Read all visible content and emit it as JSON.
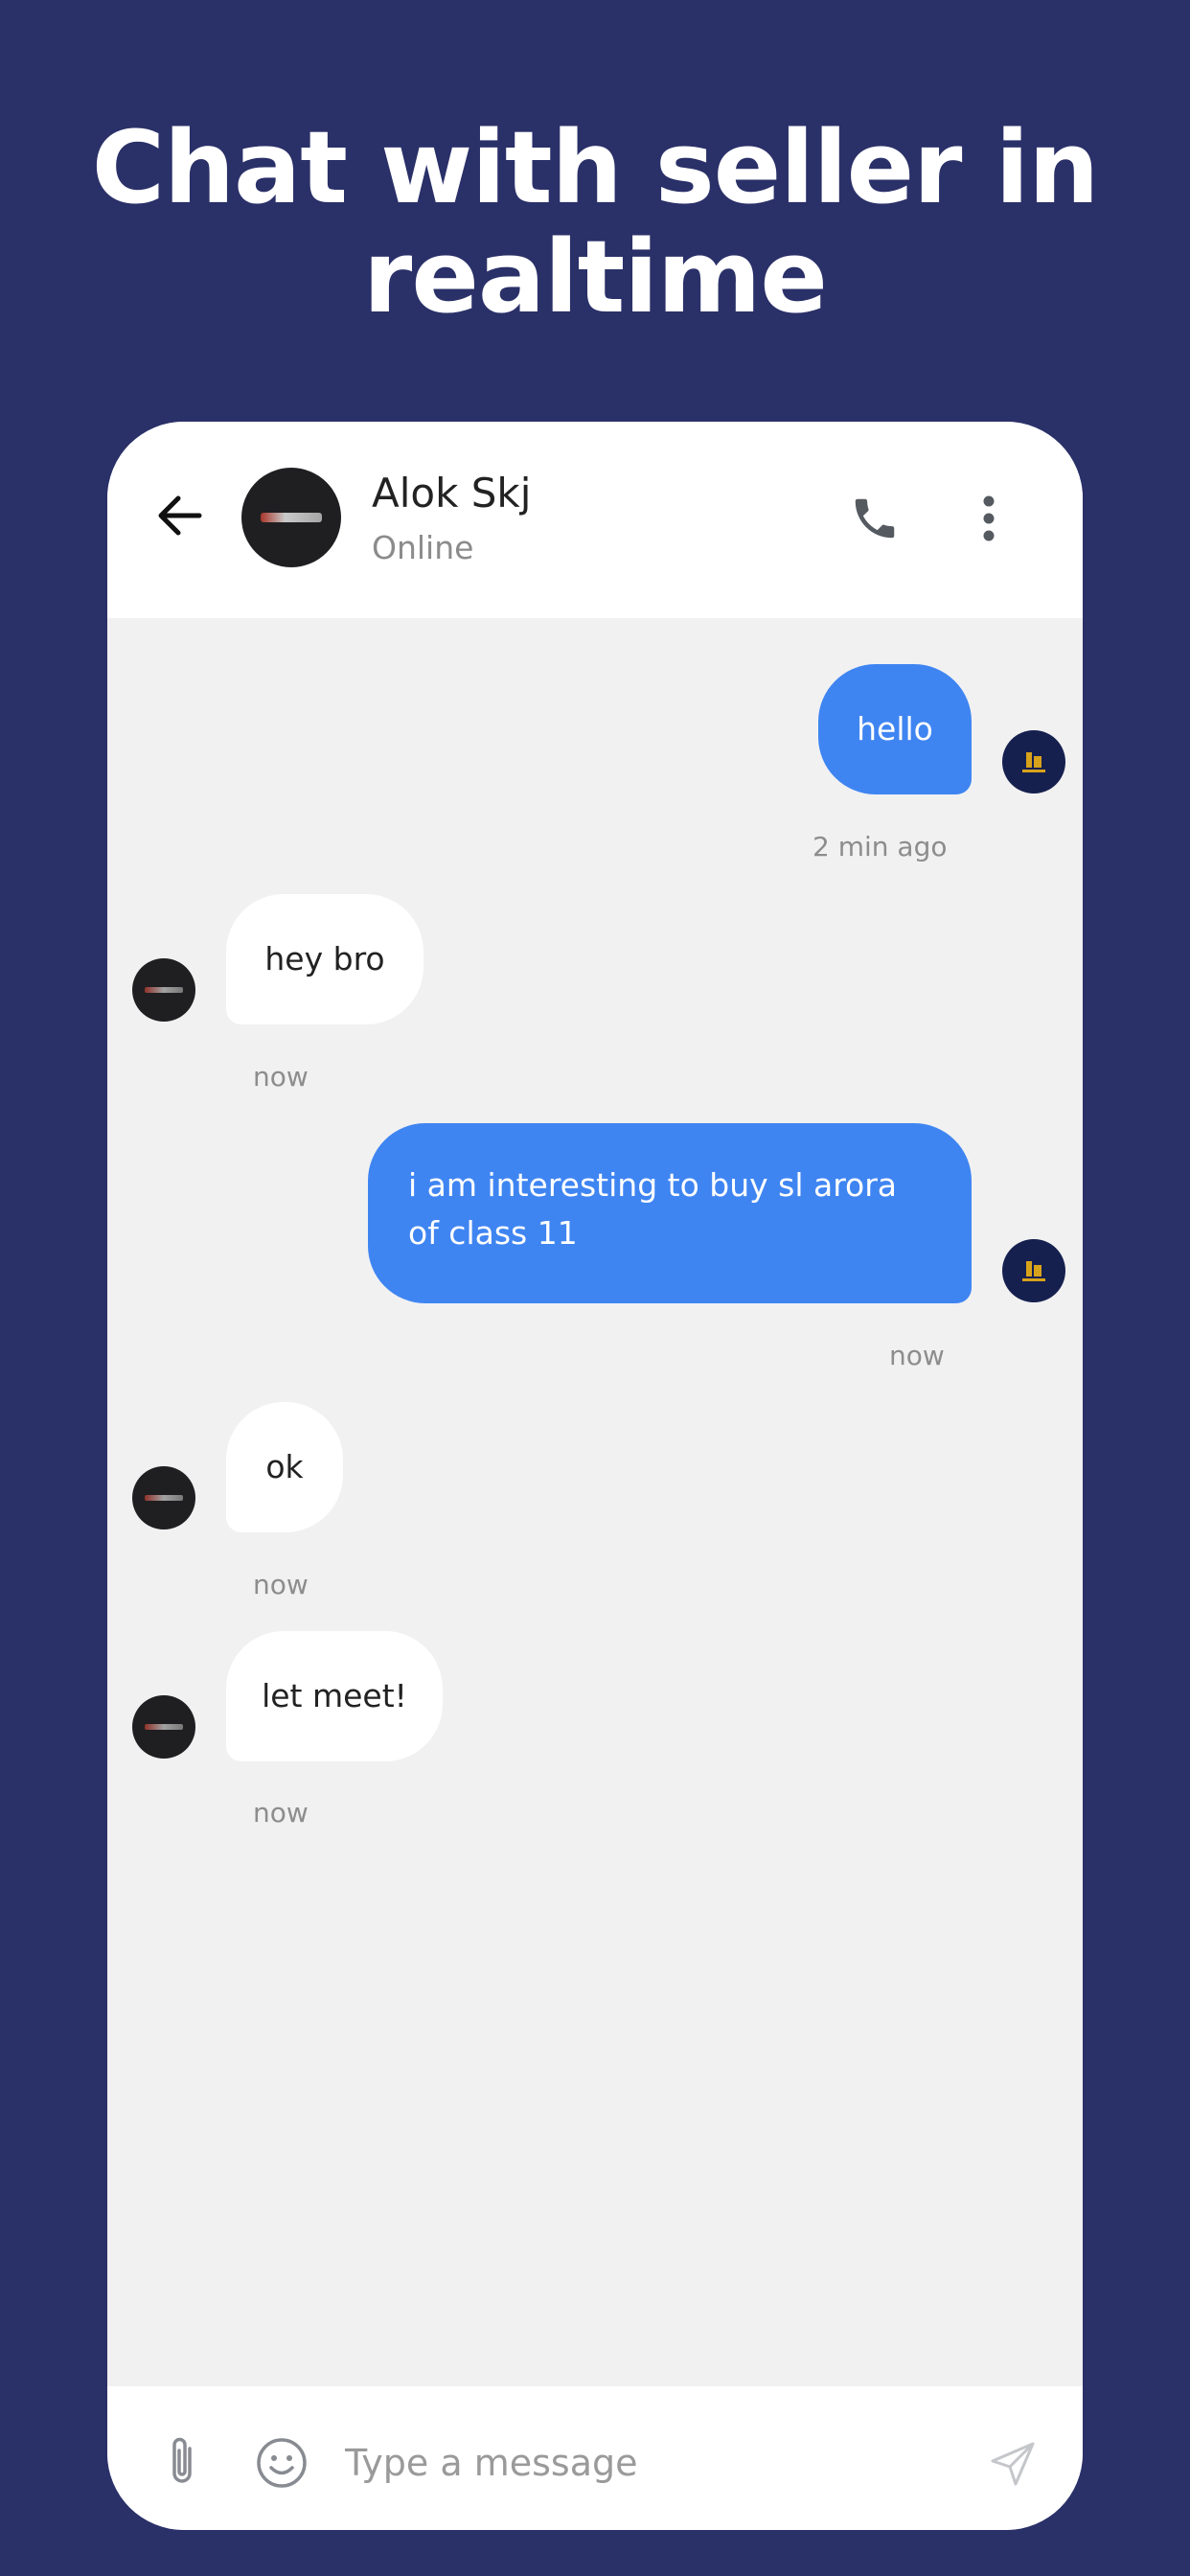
{
  "promo": {
    "headline_line1": "Chat with seller in",
    "headline_line2": "realtime"
  },
  "header": {
    "contact_name": "Alok Skj",
    "status": "Online",
    "icons": {
      "back": "arrow-left-icon",
      "call": "phone-icon",
      "more": "more-vertical-icon"
    }
  },
  "messages": [
    {
      "direction": "outgoing",
      "text": "hello",
      "time": "2 min ago"
    },
    {
      "direction": "incoming",
      "text": "hey bro",
      "time": "now"
    },
    {
      "direction": "outgoing",
      "text": "i am interesting to buy sl arora of class 11",
      "time": "now"
    },
    {
      "direction": "incoming",
      "text": "ok",
      "time": "now"
    },
    {
      "direction": "incoming",
      "text": "let meet!",
      "time": "now"
    }
  ],
  "input": {
    "placeholder": "Type a message",
    "value": "",
    "icons": {
      "attach": "paperclip-icon",
      "emoji": "smiley-icon",
      "send": "send-icon"
    }
  },
  "colors": {
    "background": "#2a3068",
    "outgoing_bubble": "#3f85f2",
    "incoming_bubble": "#ffffff",
    "chat_background": "#f1f1f2"
  }
}
